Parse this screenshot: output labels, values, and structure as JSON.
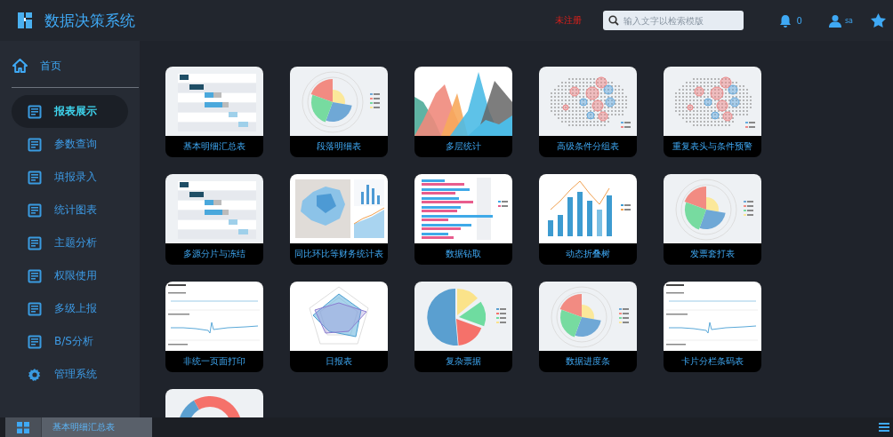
{
  "header": {
    "title": "数据决策系统",
    "register_link": "未注册",
    "search": {
      "placeholder": "输入文字以检索模版"
    },
    "notification_count": "0",
    "user": "sa"
  },
  "sidebar": {
    "home": "首页",
    "items": [
      {
        "label": "报表展示",
        "kind": "report",
        "selected": true
      },
      {
        "label": "参数查询",
        "kind": "report",
        "selected": false
      },
      {
        "label": "填报录入",
        "kind": "report",
        "selected": false
      },
      {
        "label": "统计图表",
        "kind": "report",
        "selected": false
      },
      {
        "label": "主题分析",
        "kind": "report",
        "selected": false
      },
      {
        "label": "权限使用",
        "kind": "report",
        "selected": false
      },
      {
        "label": "多级上报",
        "kind": "report",
        "selected": false
      },
      {
        "label": "B/S分析",
        "kind": "report",
        "selected": false
      },
      {
        "label": "管理系统",
        "kind": "settings",
        "selected": false
      }
    ]
  },
  "cards": [
    {
      "label": "基本明细汇总表",
      "kind": "gantt"
    },
    {
      "label": "段落明细表",
      "kind": "polar"
    },
    {
      "label": "多层统计",
      "kind": "area"
    },
    {
      "label": "高级条件分组表",
      "kind": "map"
    },
    {
      "label": "重复表头与条件预警",
      "kind": "map"
    },
    {
      "label": "多源分片与冻结",
      "kind": "gantt"
    },
    {
      "label": "同比环比等财务统计表",
      "kind": "mapcombo"
    },
    {
      "label": "数据钻取",
      "kind": "hbar"
    },
    {
      "label": "动态折叠树",
      "kind": "combo"
    },
    {
      "label": "发票套打表",
      "kind": "polar"
    },
    {
      "label": "非统一页面打印",
      "kind": "metrics"
    },
    {
      "label": "日报表",
      "kind": "radar"
    },
    {
      "label": "复杂票据",
      "kind": "pie"
    },
    {
      "label": "数据进度条",
      "kind": "polar"
    },
    {
      "label": "卡片分栏条码表",
      "kind": "metrics"
    },
    {
      "kind": "donut"
    }
  ],
  "taskbar": {
    "tabs": [
      {
        "label": "基本明细汇总表"
      }
    ]
  }
}
